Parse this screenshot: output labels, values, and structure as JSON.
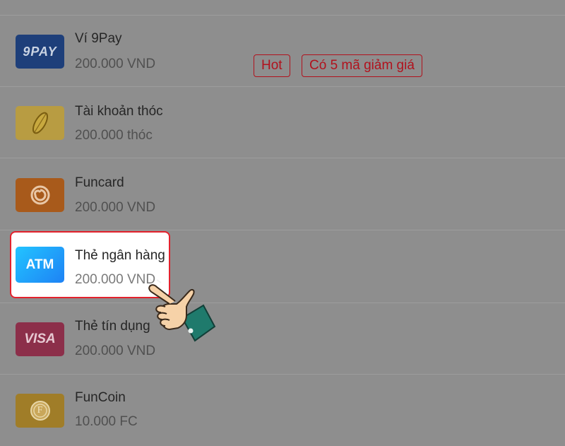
{
  "payment_methods": [
    {
      "name": "Ví 9Pay",
      "amount": "200.000 VND",
      "logo_text": "9PAY",
      "icon": "9pay-logo-icon",
      "color": "#1e3f7a",
      "tags": [
        "Hot",
        "Có 5 mã giảm giá"
      ]
    },
    {
      "name": "Tài khoản thóc",
      "amount": "200.000 thóc",
      "icon": "rice-grain-icon",
      "color": "#b89c42"
    },
    {
      "name": "Funcard",
      "amount": "200.000 VND",
      "icon": "funcard-swirl-icon",
      "color": "#a85a1b"
    },
    {
      "name": "Thẻ ngân hàng",
      "amount": "200.000 VND",
      "logo_text": "ATM",
      "icon": "atm-card-icon",
      "color": "#1e9bf0",
      "selected": true
    },
    {
      "name": "Thẻ tín dụng",
      "amount": "200.000 VND",
      "logo_text": "VISA",
      "icon": "visa-card-icon",
      "color": "#8c2f4a"
    },
    {
      "name": "FunCoin",
      "amount": "10.000 FC",
      "logo_text": "F",
      "icon": "funcoin-icon",
      "color": "#a07d28"
    }
  ],
  "colors": {
    "overlay": "#8e8e8e",
    "tag_red": "#b1121d",
    "highlight_border": "#e3222d"
  },
  "pointer": {
    "icon": "pointing-hand-icon"
  }
}
